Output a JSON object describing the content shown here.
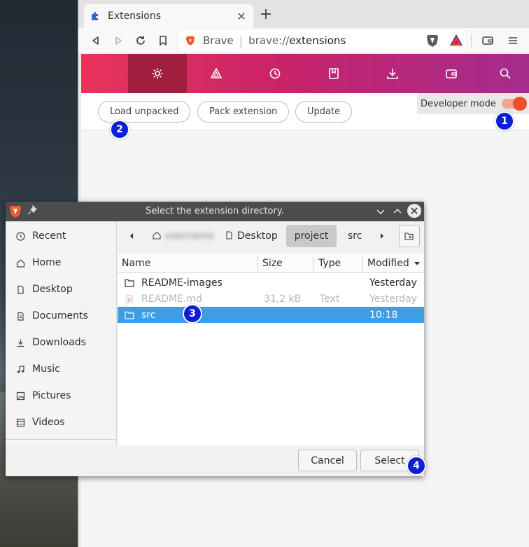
{
  "browser": {
    "tab": {
      "title": "Extensions",
      "close_glyph": "✕"
    },
    "new_tab_glyph": "+",
    "omnibox": {
      "brand": "Brave",
      "separator": "|",
      "url_scheme": "brave://",
      "url_host": "extensions"
    },
    "nav_bar": {
      "items": [
        {
          "icon": "settings-gear-icon",
          "active": true
        },
        {
          "icon": "rewards-triangle-icon"
        },
        {
          "icon": "history-icon"
        },
        {
          "icon": "bookmarks-icon"
        },
        {
          "icon": "downloads-icon"
        },
        {
          "icon": "wallet-icon"
        },
        {
          "icon": "search-icon"
        }
      ]
    },
    "extensions": {
      "buttons": {
        "load_unpacked": "Load unpacked",
        "pack_extension": "Pack extension",
        "update": "Update"
      },
      "developer_mode": {
        "label": "Developer mode",
        "enabled": true
      }
    },
    "colors": {
      "brand_gradient_start": "#e8345a",
      "brand_gradient_end": "#a52c8e",
      "active_nav": "#a01f3f",
      "toggle_on": "#ef4d2c"
    }
  },
  "markers": [
    "1",
    "2",
    "3",
    "4"
  ],
  "dialog": {
    "title": "Select the extension directory.",
    "places": [
      {
        "label": "Recent",
        "icon": "clock-icon"
      },
      {
        "label": "Home",
        "icon": "home-icon"
      },
      {
        "label": "Desktop",
        "icon": "desktop-icon"
      },
      {
        "label": "Documents",
        "icon": "documents-icon"
      },
      {
        "label": "Downloads",
        "icon": "download-icon"
      },
      {
        "label": "Music",
        "icon": "music-icon"
      },
      {
        "label": "Pictures",
        "icon": "pictures-icon"
      },
      {
        "label": "Videos",
        "icon": "videos-icon"
      }
    ],
    "breadcrumb": {
      "home_label": "username",
      "items": [
        "Desktop",
        "project",
        "src"
      ],
      "active": "project"
    },
    "columns": {
      "name": "Name",
      "size": "Size",
      "type": "Type",
      "modified": "Modified"
    },
    "files": [
      {
        "name": "README-images",
        "size": "",
        "type": "",
        "modified": "Yesterday",
        "kind": "folder",
        "state": "normal"
      },
      {
        "name": "README.md",
        "size": "31,2 kB",
        "type": "Text",
        "modified": "Yesterday",
        "kind": "file",
        "state": "dim"
      },
      {
        "name": "src",
        "size": "",
        "type": "",
        "modified": "10:18",
        "kind": "folder",
        "state": "selected"
      }
    ],
    "buttons": {
      "cancel": "Cancel",
      "select": "Select"
    },
    "colors": {
      "selection": "#3c9ee6",
      "titlebar": "#4a4c4e"
    }
  }
}
